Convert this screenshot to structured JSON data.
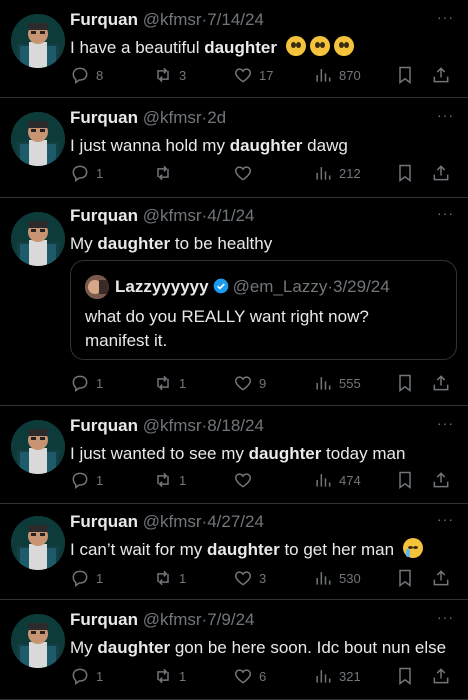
{
  "user": {
    "name": "Furquan",
    "handle": "@kfmsr"
  },
  "tweets": [
    {
      "date": "7/14/24",
      "before": "I have a beautiful ",
      "bold": "daughter",
      "after": " ",
      "emoji": "pleading",
      "replies": "8",
      "retweets": "3",
      "likes": "17",
      "views": "870"
    },
    {
      "date": "2d",
      "before": "I just wanna hold my ",
      "bold": "daughter",
      "after": " dawg",
      "replies": "1",
      "retweets": "",
      "likes": "",
      "views": "212"
    },
    {
      "date": "4/1/24",
      "before": "My ",
      "bold": "daughter",
      "after": " to be healthy",
      "replies": "1",
      "retweets": "1",
      "likes": "9",
      "views": "555",
      "quote": {
        "name": "Lazzyyyyyy",
        "handle": "@em_Lazzy",
        "date": "3/29/24",
        "text": "what do you REALLY want right now?\nmanifest it."
      }
    },
    {
      "date": "8/18/24",
      "before": "I just wanted to see my ",
      "bold": "daughter",
      "after": " today man",
      "replies": "1",
      "retweets": "1",
      "likes": "",
      "views": "474"
    },
    {
      "date": "4/27/24",
      "before": "I can’t wait for my ",
      "bold": "daughter",
      "after": " to get her man ",
      "emoji": "crying",
      "replies": "1",
      "retweets": "1",
      "likes": "3",
      "views": "530"
    },
    {
      "date": "7/9/24",
      "before": "My ",
      "bold": "daughter",
      "after": " gon be here soon. Idc bout nun else",
      "replies": "1",
      "retweets": "1",
      "likes": "6",
      "views": "321"
    }
  ],
  "icons": {
    "more": "more-icon",
    "reply": "reply-icon",
    "retweet": "retweet-icon",
    "like": "heart-icon",
    "views": "views-icon",
    "bookmark": "bookmark-icon",
    "share": "share-icon"
  },
  "colors": {
    "background": "#000000",
    "text": "#e7e9ea",
    "muted": "#71767b",
    "border": "#2f3336",
    "verified": "#1d9bf0"
  }
}
